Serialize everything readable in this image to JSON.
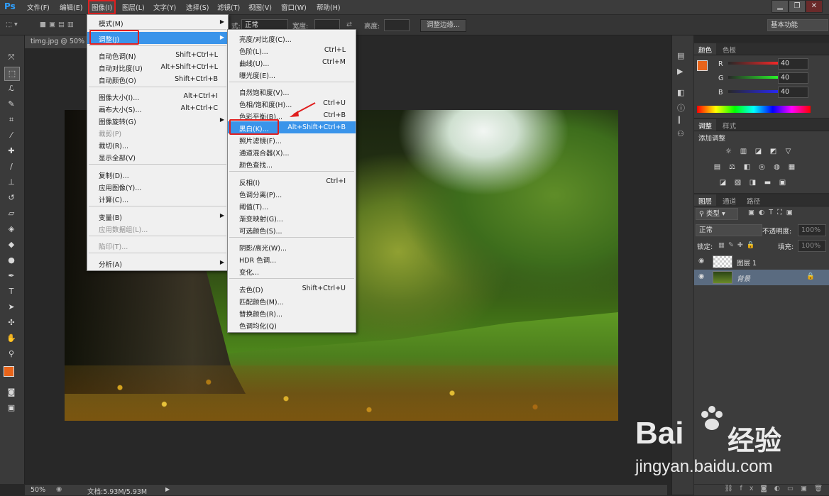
{
  "menubar": {
    "logo": "Ps",
    "items": [
      "文件(F)",
      "编辑(E)",
      "图像(I)",
      "图层(L)",
      "文字(Y)",
      "选择(S)",
      "滤镜(T)",
      "视图(V)",
      "窗口(W)",
      "帮助(H)"
    ],
    "window_buttons": [
      "▁",
      "❐",
      "✕"
    ]
  },
  "optbar": {
    "style_label": "式:",
    "style_value": "正常",
    "width_label": "宽度:",
    "height_label": "高度:",
    "refine_button": "调整边缘...",
    "workspace": "基本功能"
  },
  "document": {
    "tab_title": "timg.jpg @ 50% (",
    "zoom": "50%",
    "doc_info": "文档:5.93M/5.93M"
  },
  "image_menu": {
    "items": [
      {
        "label": "模式(M)",
        "shortcut": "",
        "submenu": true
      },
      {
        "label": "调整(J)",
        "shortcut": "",
        "submenu": true
      },
      {
        "label": "自动色调(N)",
        "shortcut": "Shift+Ctrl+L"
      },
      {
        "label": "自动对比度(U)",
        "shortcut": "Alt+Shift+Ctrl+L"
      },
      {
        "label": "自动颜色(O)",
        "shortcut": "Shift+Ctrl+B"
      },
      {
        "label": "图像大小(I)...",
        "shortcut": "Alt+Ctrl+I"
      },
      {
        "label": "画布大小(S)...",
        "shortcut": "Alt+Ctrl+C"
      },
      {
        "label": "图像旋转(G)",
        "shortcut": "",
        "submenu": true
      },
      {
        "label": "裁剪(P)",
        "shortcut": "",
        "disabled": true
      },
      {
        "label": "裁切(R)...",
        "shortcut": ""
      },
      {
        "label": "显示全部(V)",
        "shortcut": ""
      },
      {
        "label": "复制(D)...",
        "shortcut": ""
      },
      {
        "label": "应用图像(Y)...",
        "shortcut": ""
      },
      {
        "label": "计算(C)...",
        "shortcut": ""
      },
      {
        "label": "变量(B)",
        "shortcut": "",
        "submenu": true
      },
      {
        "label": "应用数据组(L)...",
        "shortcut": "",
        "disabled": true
      },
      {
        "label": "陷印(T)...",
        "shortcut": "",
        "disabled": true
      },
      {
        "label": "分析(A)",
        "shortcut": "",
        "submenu": true
      }
    ]
  },
  "adjust_menu": {
    "items": [
      {
        "label": "亮度/对比度(C)...",
        "shortcut": ""
      },
      {
        "label": "色阶(L)...",
        "shortcut": "Ctrl+L"
      },
      {
        "label": "曲线(U)...",
        "shortcut": "Ctrl+M"
      },
      {
        "label": "曝光度(E)...",
        "shortcut": ""
      },
      {
        "label": "自然饱和度(V)...",
        "shortcut": ""
      },
      {
        "label": "色相/饱和度(H)...",
        "shortcut": "Ctrl+U"
      },
      {
        "label": "色彩平衡(B)...",
        "shortcut": "Ctrl+B"
      },
      {
        "label": "黑白(K)...",
        "shortcut": "Alt+Shift+Ctrl+B"
      },
      {
        "label": "照片滤镜(F)...",
        "shortcut": ""
      },
      {
        "label": "通道混合器(X)...",
        "shortcut": ""
      },
      {
        "label": "颜色查找...",
        "shortcut": ""
      },
      {
        "label": "反相(I)",
        "shortcut": "Ctrl+I"
      },
      {
        "label": "色调分离(P)...",
        "shortcut": ""
      },
      {
        "label": "阈值(T)...",
        "shortcut": ""
      },
      {
        "label": "渐变映射(G)...",
        "shortcut": ""
      },
      {
        "label": "可选颜色(S)...",
        "shortcut": ""
      },
      {
        "label": "阴影/高光(W)...",
        "shortcut": ""
      },
      {
        "label": "HDR 色调...",
        "shortcut": ""
      },
      {
        "label": "变化...",
        "shortcut": ""
      },
      {
        "label": "去色(D)",
        "shortcut": "Shift+Ctrl+U"
      },
      {
        "label": "匹配颜色(M)...",
        "shortcut": ""
      },
      {
        "label": "替换颜色(R)...",
        "shortcut": ""
      },
      {
        "label": "色调均化(Q)",
        "shortcut": ""
      }
    ]
  },
  "color_panel": {
    "tabs": [
      "颜色",
      "色板"
    ],
    "channels": [
      {
        "name": "R",
        "value": "40"
      },
      {
        "name": "G",
        "value": "40"
      },
      {
        "name": "B",
        "value": "40"
      }
    ],
    "foreground": "#e8641a",
    "background": "#282828"
  },
  "adjust_panel": {
    "tabs": [
      "调整",
      "样式"
    ],
    "title": "添加调整"
  },
  "layers_panel": {
    "tabs": [
      "图层",
      "通道",
      "路径"
    ],
    "filter_label": "类型",
    "blend_mode": "正常",
    "opacity_label": "不透明度:",
    "opacity_value": "100%",
    "lock_label": "锁定:",
    "fill_label": "填充:",
    "fill_value": "100%",
    "layers": [
      {
        "name": "图层 1",
        "selected": false
      },
      {
        "name": "背景",
        "selected": true
      }
    ]
  },
  "watermark": {
    "brand": "Bai",
    "brand2": "经验",
    "url": "jingyan.baidu.com"
  },
  "colors": {
    "ui_dark": "#3c3c3c",
    "highlight": "#3a94ea",
    "annotation_red": "#e01e1e",
    "foreground_color": "#e8641a"
  }
}
